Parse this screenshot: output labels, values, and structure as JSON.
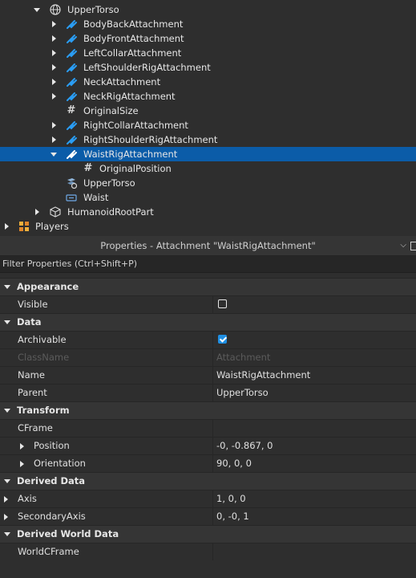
{
  "explorer": {
    "rows": [
      {
        "label": "UpperTorso",
        "icon": "globe-icon",
        "expand": "down"
      },
      {
        "label": "BodyBackAttachment",
        "icon": "attachment-icon",
        "expand": "right"
      },
      {
        "label": "BodyFrontAttachment",
        "icon": "attachment-icon",
        "expand": "right"
      },
      {
        "label": "LeftCollarAttachment",
        "icon": "attachment-icon",
        "expand": "right"
      },
      {
        "label": "LeftShoulderRigAttachment",
        "icon": "attachment-icon",
        "expand": "right"
      },
      {
        "label": "NeckAttachment",
        "icon": "attachment-icon",
        "expand": "right"
      },
      {
        "label": "NeckRigAttachment",
        "icon": "attachment-icon",
        "expand": "right"
      },
      {
        "label": "OriginalSize",
        "icon": "hash-icon",
        "expand": "none"
      },
      {
        "label": "RightCollarAttachment",
        "icon": "attachment-icon",
        "expand": "right"
      },
      {
        "label": "RightShoulderRigAttachment",
        "icon": "attachment-icon",
        "expand": "right"
      },
      {
        "label": "WaistRigAttachment",
        "icon": "attachment-icon",
        "expand": "down",
        "selected": true
      },
      {
        "label": "OriginalPosition",
        "icon": "hash-icon",
        "expand": "none"
      },
      {
        "label": "UpperTorso",
        "icon": "motor-icon",
        "expand": "none"
      },
      {
        "label": "Waist",
        "icon": "motor6d-icon",
        "expand": "none"
      },
      {
        "label": "HumanoidRootPart",
        "icon": "part-icon",
        "expand": "right"
      },
      {
        "label": "Players",
        "icon": "players-icon",
        "expand": "right"
      }
    ]
  },
  "properties": {
    "title": "Properties - Attachment \"WaistRigAttachment\"",
    "menu_icon": "chevron-down-icon",
    "filter_placeholder": "Filter Properties (Ctrl+Shift+P)",
    "categories": {
      "appearance": "Appearance",
      "data": "Data",
      "transform": "Transform",
      "derived_data": "Derived Data",
      "derived_world_data": "Derived World Data"
    },
    "fields": {
      "visible": {
        "name": "Visible",
        "checked": false
      },
      "archivable": {
        "name": "Archivable",
        "checked": true
      },
      "classname": {
        "name": "ClassName",
        "value": "Attachment"
      },
      "name": {
        "name": "Name",
        "value": "WaistRigAttachment"
      },
      "parent": {
        "name": "Parent",
        "value": "UpperTorso"
      },
      "cframe": {
        "name": "CFrame",
        "value": ""
      },
      "position": {
        "name": "Position",
        "value": "-0, -0.867, 0"
      },
      "orientation": {
        "name": "Orientation",
        "value": "90, 0, 0"
      },
      "axis": {
        "name": "Axis",
        "value": "1, 0, 0"
      },
      "secondary_axis": {
        "name": "SecondaryAxis",
        "value": "0, -0, 1"
      },
      "world_cframe": {
        "name": "WorldCFrame",
        "value": ""
      }
    }
  },
  "colors": {
    "selection": "#0b5ca8",
    "attachment_icon": "#2a9df4",
    "checkbox_on": "#1f8fe3"
  }
}
